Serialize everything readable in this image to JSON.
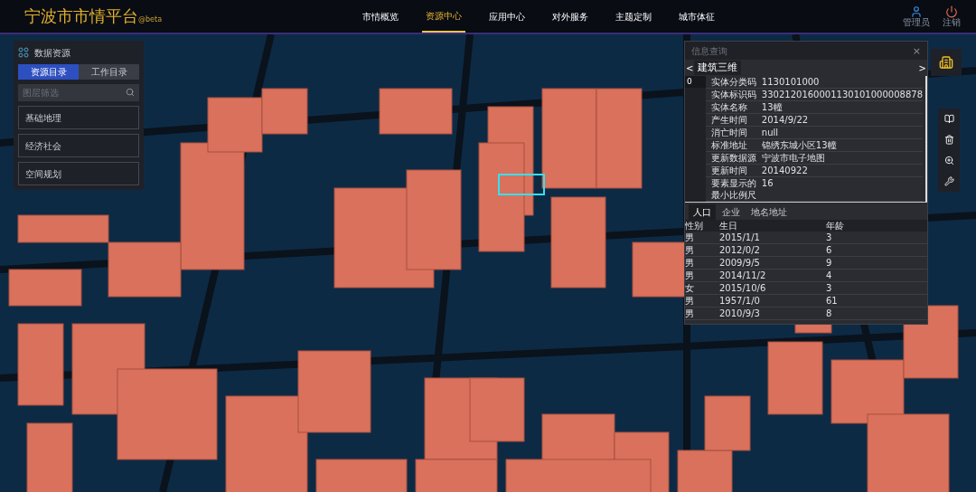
{
  "header": {
    "title": "宁波市市情平台",
    "badge": "@beta",
    "nav": [
      {
        "label": "市情概览",
        "selected": false
      },
      {
        "label": "资源中心",
        "selected": true
      },
      {
        "label": "应用中心",
        "selected": false
      },
      {
        "label": "对外服务",
        "selected": false
      },
      {
        "label": "主题定制",
        "selected": false
      },
      {
        "label": "城市体征",
        "selected": false
      }
    ],
    "user": {
      "label": "管理员"
    },
    "logout": {
      "label": "注销"
    }
  },
  "data_panel": {
    "title": "数据资源",
    "tabs": [
      {
        "label": "资源目录",
        "selected": true
      },
      {
        "label": "工作目录",
        "selected": false
      }
    ],
    "search": {
      "placeholder": "图层筛选"
    },
    "items": [
      "基础地理",
      "经济社会",
      "空间规划"
    ]
  },
  "info_panel": {
    "title": "信息查询",
    "close": "×",
    "prev": "<",
    "next": ">",
    "layer": "建筑三维",
    "index": "0",
    "attributes": [
      {
        "key": "实体分类码",
        "value": "1130101000"
      },
      {
        "key": "实体标识码",
        "value": "3302120160001130101000008878"
      },
      {
        "key": "实体名称",
        "value": "13幢"
      },
      {
        "key": "产生时间",
        "value": "2014/9/22"
      },
      {
        "key": "消亡时间",
        "value": "null"
      },
      {
        "key": "标准地址",
        "value": "锦绣东城小区13幢"
      },
      {
        "key": "更新数据源",
        "value": "宁波市电子地图"
      },
      {
        "key": "更新时间",
        "value": "20140922"
      },
      {
        "key": "要素显示的最小比例尺",
        "value": "16"
      }
    ],
    "tabs": [
      {
        "label": "人口",
        "selected": true
      },
      {
        "label": "企业",
        "selected": false
      },
      {
        "label": "地名地址",
        "selected": false
      }
    ],
    "columns": [
      "性别",
      "生日",
      "年龄"
    ],
    "rows": [
      [
        "男",
        "2015/1/1",
        "3"
      ],
      [
        "男",
        "2012/0/2",
        "6"
      ],
      [
        "男",
        "2009/9/5",
        "9"
      ],
      [
        "男",
        "2014/11/2",
        "4"
      ],
      [
        "女",
        "2015/10/6",
        "3"
      ],
      [
        "男",
        "1957/1/0",
        "61"
      ],
      [
        "男",
        "2010/9/3",
        "8"
      ]
    ]
  }
}
